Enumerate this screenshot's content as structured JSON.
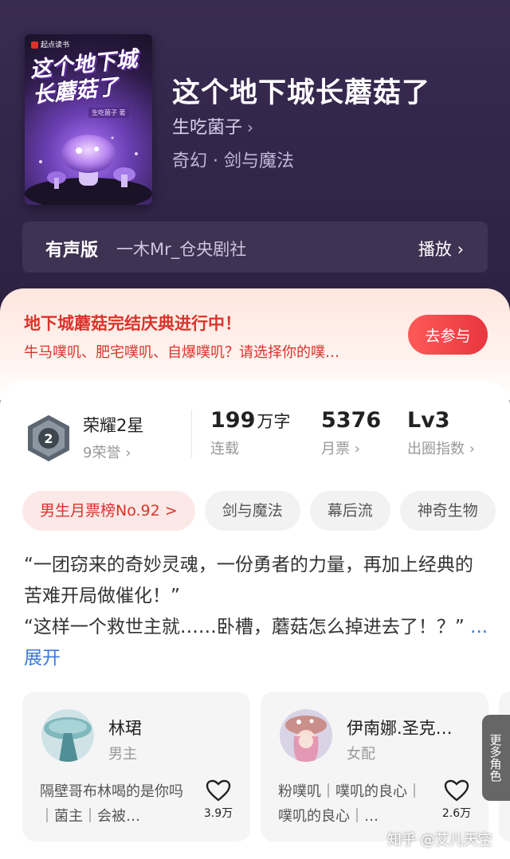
{
  "cover": {
    "publisher": "起点读书",
    "title": "这个地下城长蘑菇了",
    "author_tag": "生吃菌子 著"
  },
  "book": {
    "title": "这个地下城长蘑菇了",
    "author": "生吃菌子",
    "genre": "奇幻 · 剑与魔法"
  },
  "audio": {
    "label": "有声版",
    "narrator": "一木Mr_仓央剧社",
    "play_label": "播放"
  },
  "promo": {
    "title": "地下城蘑菇完结庆典进行中！",
    "subtitle": "牛马噗叽、肥宅噗叽、自爆噗叽？请选择你的噗…",
    "button": "去参与"
  },
  "honor": {
    "title": "荣耀2星",
    "sub": "9荣誉",
    "badge_number": "2"
  },
  "stats": [
    {
      "value": "199",
      "unit": "万字",
      "caption": "连载"
    },
    {
      "value": "5376",
      "unit": "",
      "caption": "月票"
    },
    {
      "value": "Lv3",
      "unit": "",
      "caption": "出圈指数"
    }
  ],
  "tags": [
    "男生月票榜No.92 >",
    "剑与魔法",
    "幕后流",
    "神奇生物"
  ],
  "description": {
    "text": "“一团窃来的奇妙灵魂，一份勇者的力量，再加上经典的苦难开局做催化！”\n“这样一个救世主就……卧槽，蘑菇怎么掉进去了！？”",
    "more": "...展开"
  },
  "characters": [
    {
      "name": "林珺",
      "role": "男主",
      "desc": "隔壁哥布林喝的是你吗｜菌主｜会被…",
      "likes": "3.9万"
    },
    {
      "name": "伊南娜.圣克…",
      "role": "女配",
      "desc": "粉噗叽｜噗叽的良心｜噗叽的良心｜…",
      "likes": "2.6万"
    }
  ],
  "more_roles": "更多角色",
  "watermark": "知乎 @艾儿天空",
  "colors": {
    "accent_red": "#d9342b",
    "link_blue": "#3a7bd5",
    "hero_bg": "#33264a"
  }
}
